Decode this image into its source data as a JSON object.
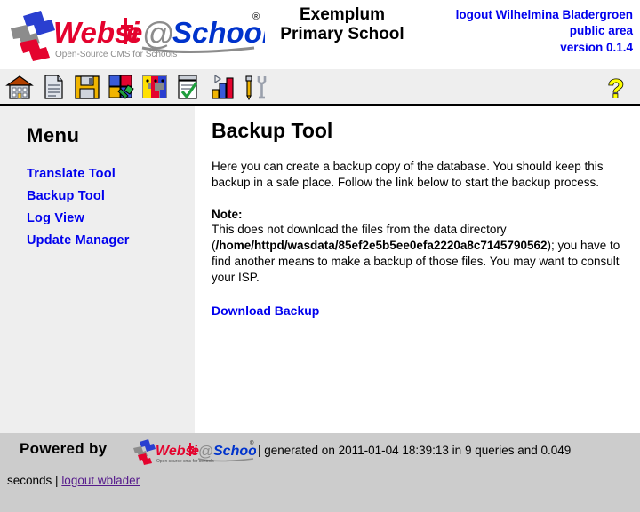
{
  "header": {
    "logo_alt": "Website@School",
    "logo_main_word1": "Websi",
    "logo_main_word2": "e",
    "logo_at": "@",
    "logo_word3": "School",
    "logo_tagline": "Open-Source CMS for Schools",
    "logo_registered": "®",
    "school_name_line1": "Exemplum",
    "school_name_line2": "Primary School",
    "logout_label": "logout Wilhelmina Bladergroen",
    "area_label": "public area",
    "version_label": "version 0.1.4"
  },
  "toolbar": {
    "icons": [
      {
        "name": "home-icon",
        "title": "Home"
      },
      {
        "name": "page-icon",
        "title": "Pages"
      },
      {
        "name": "save-icon",
        "title": "Save"
      },
      {
        "name": "modules-icon",
        "title": "Modules"
      },
      {
        "name": "areas-icon",
        "title": "Areas"
      },
      {
        "name": "tasks-icon",
        "title": "Tasks"
      },
      {
        "name": "statistics-icon",
        "title": "Statistics"
      },
      {
        "name": "tools-icon",
        "title": "Tools"
      }
    ],
    "help_icon": "help-question-icon",
    "help_title": "Help"
  },
  "sidebar": {
    "title": "Menu",
    "items": [
      {
        "label": "Translate Tool",
        "active": false
      },
      {
        "label": "Backup Tool",
        "active": true
      },
      {
        "label": "Log View",
        "active": false
      },
      {
        "label": "Update Manager",
        "active": false
      }
    ]
  },
  "main": {
    "title": "Backup Tool",
    "intro": "Here you can create a backup copy of the database. You should keep this backup in a safe place. Follow the link below to start the backup process.",
    "note_label": "Note:",
    "note_part1": "This does not download the files from the data directory (",
    "note_path": "/home/httpd/wasdata/85ef2e5b5ee0efa2220a8c7145790562",
    "note_part2": "); you have to find another means to make a backup of those files. You may want to consult your ISP.",
    "download_link": "Download Backup"
  },
  "footer": {
    "powered_by": "Powered by",
    "logo_tagline": "Open source cms for schools",
    "generated": "| generated on 2011-01-04 18:39:13 in 9 queries and 0.049",
    "seconds_prefix": "seconds |",
    "logout_link": "logout wblader"
  },
  "colors": {
    "link": "#0000ee",
    "visited_link": "#551a8b",
    "sidebar_bg": "#eeeeee",
    "footer_bg": "#cccccc",
    "logo_red": "#e4032e",
    "logo_blue": "#0033cc",
    "help_yellow": "#ffff00"
  }
}
